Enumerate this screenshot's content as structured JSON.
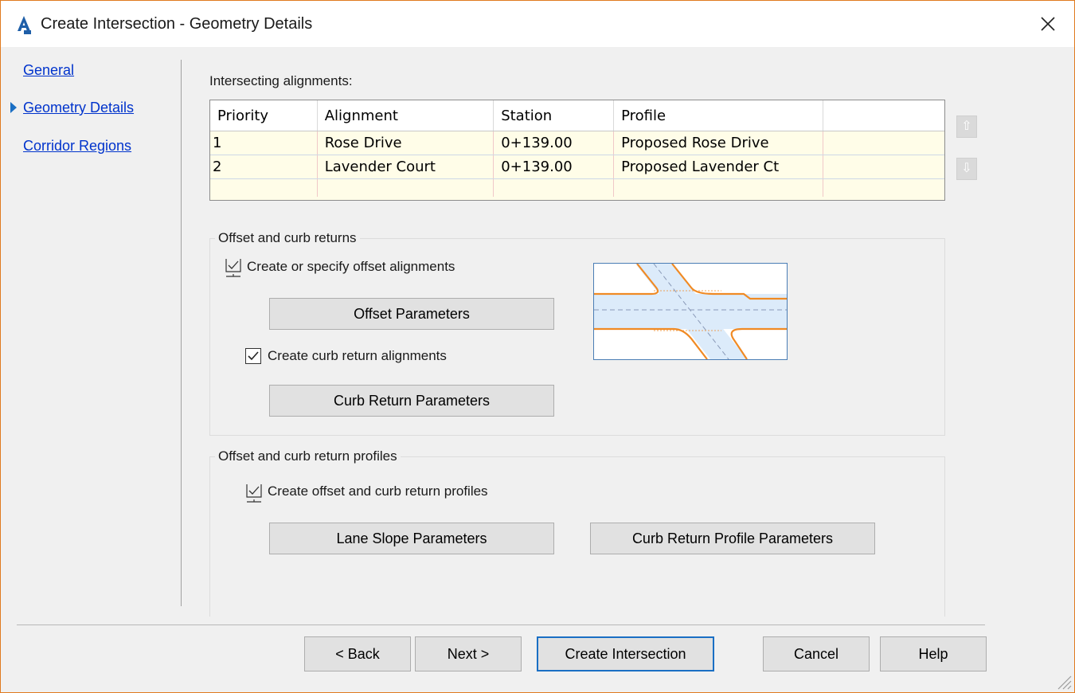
{
  "window": {
    "title": "Create Intersection - Geometry Details"
  },
  "nav": {
    "items": [
      {
        "label": "General",
        "current": false
      },
      {
        "label": "Geometry Details",
        "current": true
      },
      {
        "label": "Corridor Regions",
        "current": false
      }
    ]
  },
  "alignments": {
    "label": "Intersecting alignments:",
    "columns": [
      "Priority",
      "Alignment",
      "Station",
      "Profile",
      ""
    ],
    "rows": [
      [
        "1",
        "Rose Drive",
        "0+139.00",
        "Proposed Rose Drive",
        ""
      ],
      [
        "2",
        "Lavender Court",
        "0+139.00",
        "Proposed Lavender Ct",
        ""
      ]
    ]
  },
  "offset_group": {
    "title": "Offset and curb returns",
    "create_offset_label": "Create or specify offset alignments",
    "offset_button": "Offset Parameters",
    "create_curb_label": "Create curb return alignments",
    "create_curb_checked": true,
    "curb_button": "Curb Return Parameters"
  },
  "profiles_group": {
    "title": "Offset and curb return profiles",
    "create_profiles_label": "Create offset and curb return profiles",
    "lane_slope_button": "Lane Slope Parameters",
    "curb_profile_button": "Curb Return Profile Parameters"
  },
  "footer": {
    "back": "< Back",
    "next": "Next >",
    "create": "Create Intersection",
    "cancel": "Cancel",
    "help": "Help"
  },
  "colors": {
    "accent": "#1a6fc4",
    "link": "#0033cc",
    "road_edge": "#f08a24",
    "road_fill": "#dcebfa",
    "window_border": "#e07a1f",
    "grid_row_bg": "#fffde8"
  }
}
